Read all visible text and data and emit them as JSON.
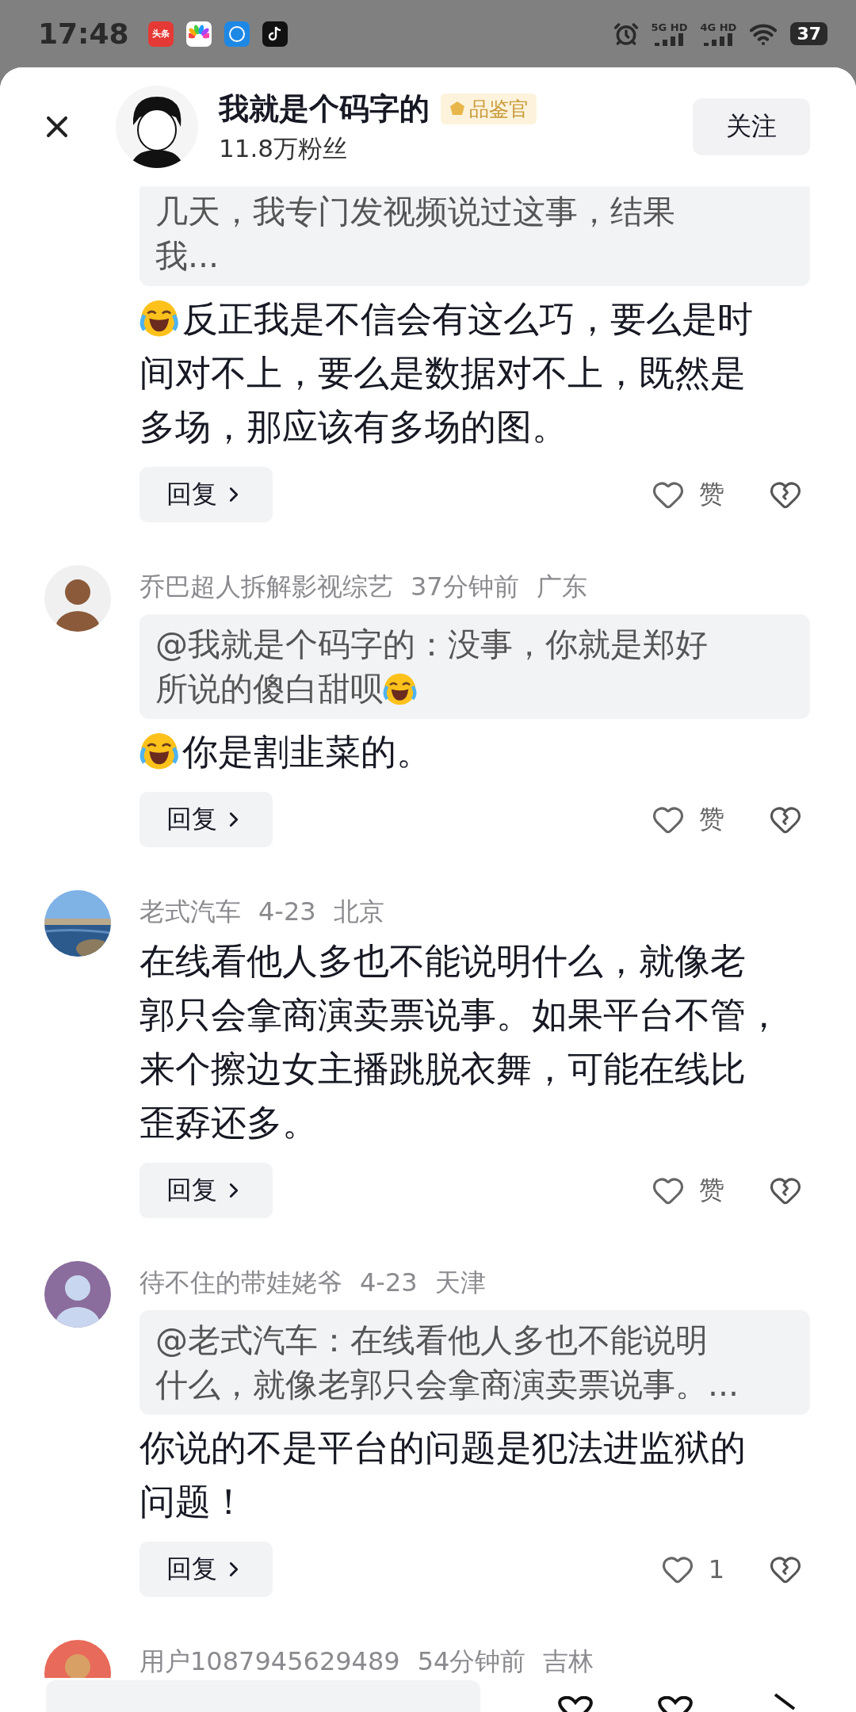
{
  "status_bar": {
    "time": "17:48",
    "app_badge": "头条",
    "networks": [
      "5G HD",
      "4G HD"
    ],
    "battery": "37"
  },
  "header": {
    "name": "我就是个码字的",
    "badge": "品鉴官",
    "followers": "11.8万粉丝",
    "follow_button": "关注"
  },
  "comments": [
    {
      "quote": {
        "lines": [
          "几天，我专门发视频说过这事，结果",
          "我..."
        ],
        "trailing_emoji": false
      },
      "body": {
        "leading_emoji": true,
        "lines": [
          "反正我是不信会有这么巧，要么是时",
          "间对不上，要么是数据对不上，既然是",
          "多场，那应该有多场的图。"
        ]
      },
      "reply": "回复",
      "like": "赞"
    },
    {
      "author": "乔巴超人拆解影视综艺",
      "time": "37分钟前",
      "location": "广东",
      "quote": {
        "lines": [
          "@我就是个码字的：没事，你就是郑好",
          "所说的傻白甜呗"
        ],
        "trailing_emoji": true
      },
      "body": {
        "leading_emoji": true,
        "lines": [
          "你是割韭菜的。"
        ]
      },
      "reply": "回复",
      "like": "赞"
    },
    {
      "author": "老式汽车",
      "time": "4-23",
      "location": "北京",
      "body": {
        "leading_emoji": false,
        "lines": [
          "在线看他人多也不能说明什么，就像老",
          "郭只会拿商演卖票说事。如果平台不管，",
          "来个擦边女主播跳脱衣舞，可能在线比",
          "歪孬还多。"
        ]
      },
      "reply": "回复",
      "like": "赞"
    },
    {
      "author": "待不住的带娃姥爷",
      "time": "4-23",
      "location": "天津",
      "quote": {
        "lines": [
          "@老式汽车：在线看他人多也不能说明",
          "什么，就像老郭只会拿商演卖票说事。..."
        ],
        "trailing_emoji": false
      },
      "body": {
        "leading_emoji": false,
        "lines": [
          "你说的不是平台的问题是犯法进监狱的",
          "问题！"
        ]
      },
      "reply": "回复",
      "like": "1"
    },
    {
      "author": "用户1087945629489",
      "time": "54分钟前",
      "location": "吉林"
    }
  ]
}
